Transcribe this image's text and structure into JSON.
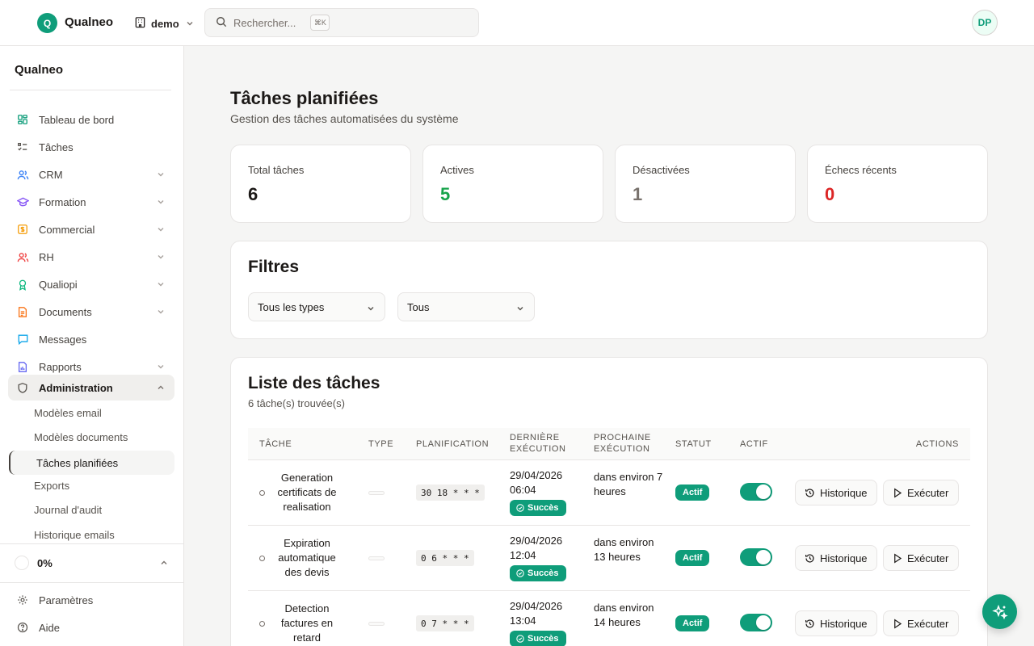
{
  "header": {
    "logo_letter": "Q",
    "app_name": "Qualneo",
    "tenant": "demo",
    "search_placeholder": "Rechercher...",
    "search_shortcut": "⌘K",
    "avatar_initials": "DP"
  },
  "sidebar": {
    "brand": "Qualneo",
    "items": [
      {
        "label": "Tableau de bord",
        "icon": "dashboard-icon"
      },
      {
        "label": "Tâches",
        "icon": "list-check-icon"
      },
      {
        "label": "CRM",
        "icon": "users-icon"
      },
      {
        "label": "Formation",
        "icon": "graduation-cap-icon"
      },
      {
        "label": "Commercial",
        "icon": "dollar-square-icon"
      },
      {
        "label": "RH",
        "icon": "user-group-icon"
      },
      {
        "label": "Qualiopi",
        "icon": "award-icon"
      },
      {
        "label": "Documents",
        "icon": "file-text-icon"
      },
      {
        "label": "Messages",
        "icon": "message-icon"
      },
      {
        "label": "Rapports",
        "icon": "report-icon"
      },
      {
        "label": "Administration",
        "icon": "shield-icon"
      }
    ],
    "subitems": [
      "Modèles email",
      "Modèles documents",
      "Tâches planifiées",
      "Exports",
      "Journal d'audit",
      "Historique emails"
    ],
    "progress": "0%",
    "footer": [
      {
        "label": "Paramètres",
        "icon": "gear-icon"
      },
      {
        "label": "Aide",
        "icon": "help-circle-icon"
      }
    ]
  },
  "page": {
    "title": "Tâches planifiées",
    "subtitle": "Gestion des tâches automatisées du système"
  },
  "stats": [
    {
      "label": "Total tâches",
      "value": "6",
      "color": "#1c1917"
    },
    {
      "label": "Actives",
      "value": "5",
      "color": "#16a34a"
    },
    {
      "label": "Désactivées",
      "value": "1",
      "color": "#78716c"
    },
    {
      "label": "Échecs récents",
      "value": "0",
      "color": "#dc2626"
    }
  ],
  "filters": {
    "title": "Filtres",
    "type_select": "Tous les types",
    "status_select": "Tous"
  },
  "tasks": {
    "title": "Liste des tâches",
    "count": "6 tâche(s) trouvée(s)",
    "columns": {
      "task": "TÂCHE",
      "type": "TYPE",
      "schedule": "PLANIFICATION",
      "last_1": "DERNIÈRE",
      "last_2": "EXÉCUTION",
      "next_1": "PROCHAINE",
      "next_2": "EXÉCUTION",
      "status": "STATUT",
      "active": "ACTIF",
      "actions": "ACTIONS"
    },
    "rows": [
      {
        "name": "Generation certificats de realisation",
        "cron": "30 18 * * *",
        "last_date": "29/04/2026",
        "last_time": "06:04",
        "result": "Succès",
        "next": "dans environ 7 heures",
        "status": "Actif",
        "active": true
      },
      {
        "name": "Expiration automatique des devis",
        "cron": "0 6 * * *",
        "last_date": "29/04/2026",
        "last_time": "12:04",
        "result": "Succès",
        "next": "dans environ 13 heures",
        "status": "Actif",
        "active": true
      },
      {
        "name": "Detection factures en retard",
        "cron": "0 7 * * *",
        "last_date": "29/04/2026",
        "last_time": "13:04",
        "result": "Succès",
        "next": "dans environ 14 heures",
        "status": "Actif",
        "active": true
      }
    ],
    "history_label": "Historique",
    "run_label": "Exécuter"
  }
}
